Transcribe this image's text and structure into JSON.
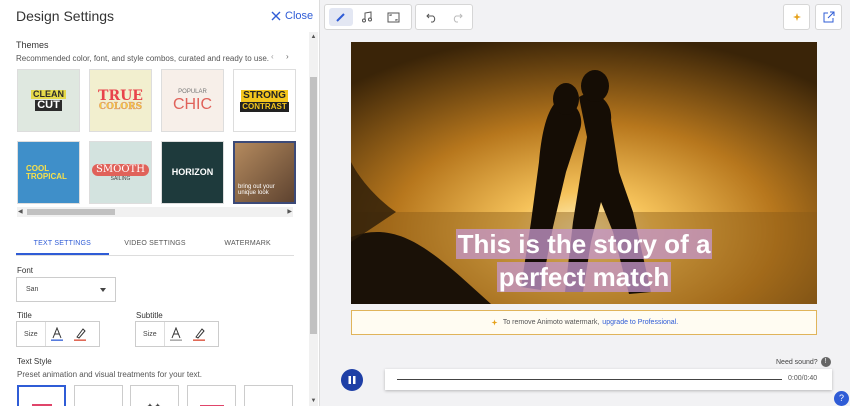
{
  "panel": {
    "title": "Design Settings",
    "close_label": "Close"
  },
  "themes": {
    "heading": "Themes",
    "subtitle": "Recommended color, font, and style combos, curated and ready to use.",
    "tiles": [
      {
        "lines": [
          "CLEAN",
          "CUT"
        ],
        "bg": "#dfe8e0"
      },
      {
        "lines": [
          "TRUE",
          "COLORS"
        ],
        "bg": "#f2efcf"
      },
      {
        "lines": [
          "POPULAR",
          "CHIC"
        ],
        "bg": "#f7efe9"
      },
      {
        "lines": [
          "STRONG",
          "CONTRAST"
        ],
        "bg": "#ffffff"
      },
      {
        "lines": [
          "COOL",
          "TROPICAL"
        ],
        "bg": "#3f8fc9"
      },
      {
        "lines": [
          "SMOOTH",
          "SAILING"
        ],
        "bg": "#d3e3df"
      },
      {
        "lines": [
          "HORIZON"
        ],
        "bg": "#1e3a3c"
      },
      {
        "lines": [
          "bring out your",
          "unique look"
        ],
        "bg": "#8a6a4c"
      }
    ]
  },
  "tabs": [
    "TEXT SETTINGS",
    "VIDEO SETTINGS",
    "WATERMARK"
  ],
  "font": {
    "label": "Font",
    "value": "San"
  },
  "title_ctrl": {
    "label": "Title",
    "size_label": "Size"
  },
  "subtitle_ctrl": {
    "label": "Subtitle",
    "size_label": "Size"
  },
  "text_style": {
    "label": "Text Style",
    "subtitle": "Preset animation and visual treatments for your text."
  },
  "video": {
    "caption_line1": "This is the story of a",
    "caption_line2": "perfect match"
  },
  "watermark_notice": {
    "text": "To remove Animoto watermark,",
    "link": "upgrade to Professional."
  },
  "player": {
    "need_sound": "Need sound?",
    "time": "0:00/0:40"
  },
  "colors": {
    "accent": "#2f5cd6",
    "play": "#1e3fa6"
  }
}
